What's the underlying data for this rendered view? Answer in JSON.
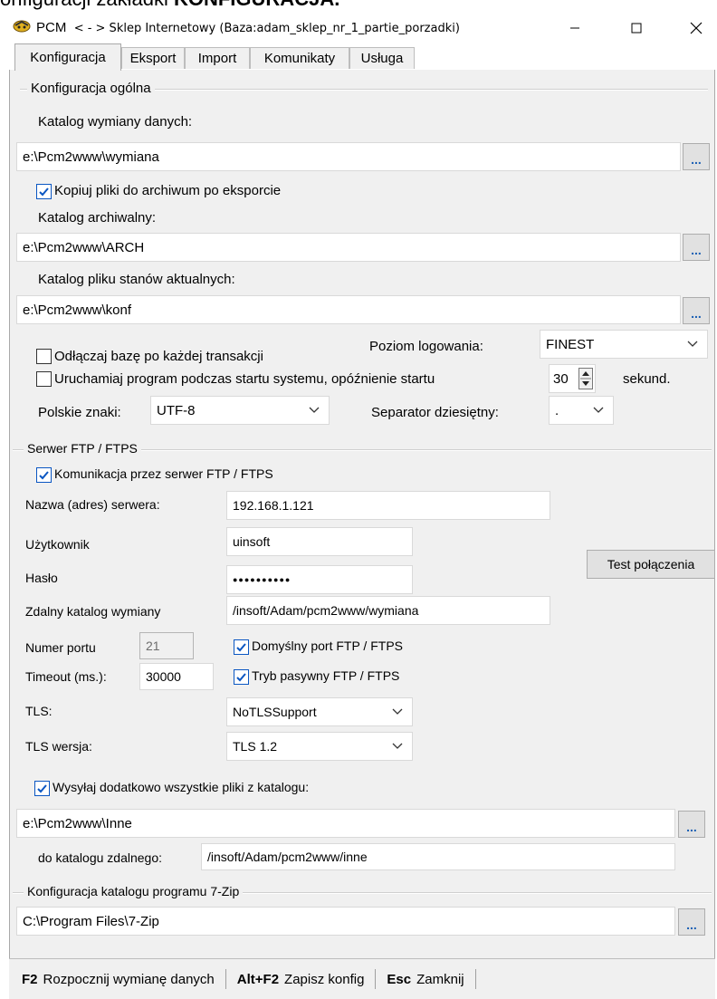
{
  "doc_fragment": {
    "prefix": "onfiguracji zakładki ",
    "bold": "KONFIGURACJA."
  },
  "window": {
    "app_name": "PCM",
    "title_rest": "< - > Sklep Internetowy (Baza:adam_sklep_nr_1_partie_porzadki)"
  },
  "tabs": [
    "Konfiguracja",
    "Eksport",
    "Import",
    "Komunikaty",
    "Usługa"
  ],
  "general": {
    "group_title": "Konfiguracja ogólna",
    "exchange_dir_label": "Katalog wymiany danych:",
    "exchange_dir_value": "e:\\Pcm2www\\wymiana",
    "copy_to_archive_label": "Kopiuj pliki do archiwum po eksporcie",
    "copy_to_archive_checked": true,
    "archive_dir_label": "Katalog archiwalny:",
    "archive_dir_value": "e:\\Pcm2www\\ARCH",
    "stock_dir_label": "Katalog pliku stanów aktualnych:",
    "stock_dir_value": "e:\\Pcm2www\\konf",
    "disconnect_label": "Odłączaj bazę po każdej transakcji",
    "disconnect_checked": false,
    "log_level_label": "Poziom logowania:",
    "log_level_value": "FINEST",
    "autostart_label": "Uruchamiaj program podczas startu systemu,  opóźnienie startu",
    "autostart_checked": false,
    "delay_value": "30",
    "delay_unit": "sekund.",
    "charset_label": "Polskie znaki:",
    "charset_value": "UTF-8",
    "decimal_sep_label": "Separator dziesiętny:",
    "decimal_sep_value": ".",
    "browse_label": "..."
  },
  "ftp": {
    "group_title": "Serwer FTP / FTPS",
    "enable_label": "Komunikacja przez serwer FTP / FTPS",
    "enable_checked": true,
    "server_label": "Nazwa (adres) serwera:",
    "server_value": "192.168.1.121",
    "user_label": "Użytkownik",
    "user_value": "uinsoft",
    "password_label": "Hasło",
    "password_value": "●●●●●●●●●●",
    "remote_dir_label": "Zdalny katalog wymiany",
    "remote_dir_value": "/insoft/Adam/pcm2www/wymiana",
    "port_label": "Numer portu",
    "port_value": "21",
    "default_port_label": "Domyślny port FTP / FTPS",
    "default_port_checked": true,
    "timeout_label": "Timeout (ms.):",
    "timeout_value": "30000",
    "passive_label": "Tryb pasywny FTP / FTPS",
    "passive_checked": true,
    "tls_label": "TLS:",
    "tls_value": "NoTLSSupport",
    "tls_version_label": "TLS wersja:",
    "tls_version_value": "TLS 1.2",
    "test_button": "Test połączenia",
    "send_all_label": "Wysyłaj dodatkowo wszystkie pliki z katalogu:",
    "send_all_checked": true,
    "local_dir_value": "e:\\Pcm2www\\Inne",
    "to_remote_label": "do katalogu zdalnego:",
    "to_remote_value": "/insoft/Adam/pcm2www/inne"
  },
  "zip": {
    "group_title": "Konfiguracja katalogu programu 7-Zip",
    "dir_value": "C:\\Program Files\\7-Zip"
  },
  "statusbar": [
    {
      "key": "F2",
      "label": "Rozpocznij wymianę danych"
    },
    {
      "key": "Alt+F2",
      "label": "Zapisz konfig"
    },
    {
      "key": "Esc",
      "label": "Zamknij"
    }
  ]
}
